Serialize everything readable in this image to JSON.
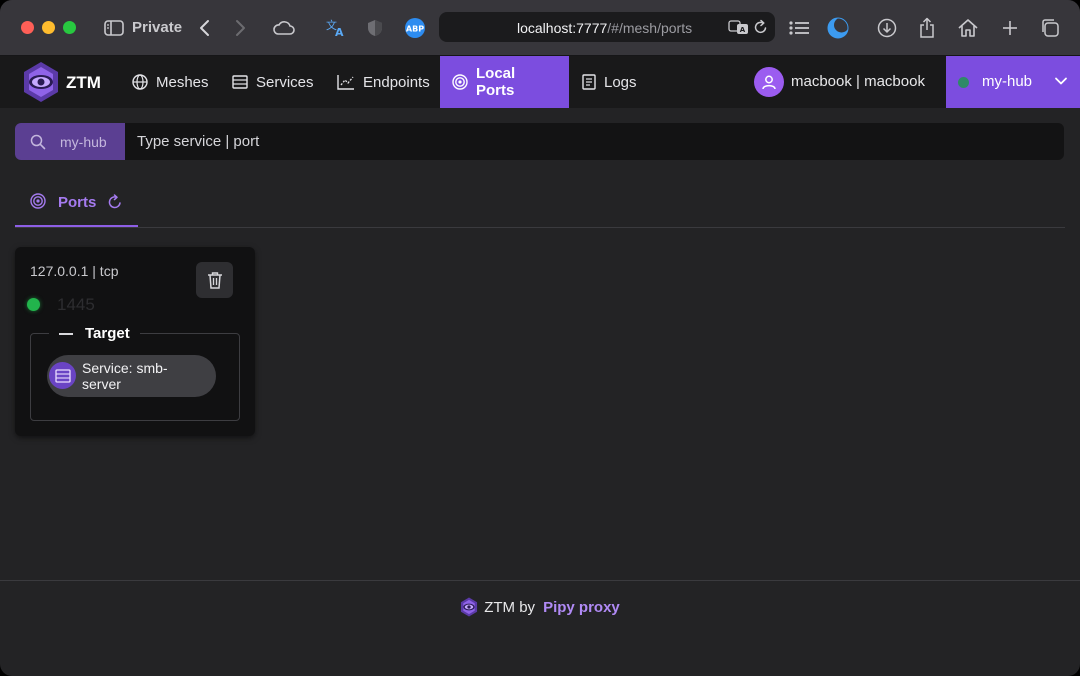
{
  "browser": {
    "private_label": "Private",
    "url_host": "localhost:7777",
    "url_path": "/#/mesh/ports",
    "colors": {
      "close": "#fe5f57",
      "minimize": "#febc2e",
      "zoom": "#28c840"
    },
    "toolbar_icons": [
      "sidebar-icon",
      "back-icon",
      "forward-icon",
      "cloud-icon",
      "translate-icon",
      "shield-icon",
      "adblock-icon",
      "translate-page-icon",
      "reload-icon",
      "reading-list-icon",
      "theme-icon",
      "download-icon",
      "share-icon",
      "home-icon",
      "new-tab-icon",
      "tabs-overview-icon"
    ],
    "adblock_label": "ABP"
  },
  "app": {
    "brand": "ZTM",
    "nav": [
      {
        "label": "Meshes",
        "icon": "globe-icon"
      },
      {
        "label": "Services",
        "icon": "server-icon"
      },
      {
        "label": "Endpoints",
        "icon": "chart-icon"
      },
      {
        "label": "Local Ports",
        "icon": "target-icon",
        "active": true
      },
      {
        "label": "Logs",
        "icon": "document-icon"
      }
    ],
    "user": "macbook | macbook",
    "hub": {
      "name": "my-hub",
      "status_color": "#2e8a67"
    },
    "accent": "#7c4ddf"
  },
  "search": {
    "scope": "my-hub",
    "placeholder": "Type service | port"
  },
  "tabs": [
    {
      "label": "Ports",
      "icon": "target-icon",
      "action_icon": "refresh-icon"
    }
  ],
  "ports": [
    {
      "title": "127.0.0.1 | tcp",
      "port": "1445",
      "status_color": "#22b44c",
      "target_label": "Target",
      "target": "Service: smb-server"
    }
  ],
  "footer": {
    "by": "ZTM by",
    "link": "Pipy proxy"
  }
}
